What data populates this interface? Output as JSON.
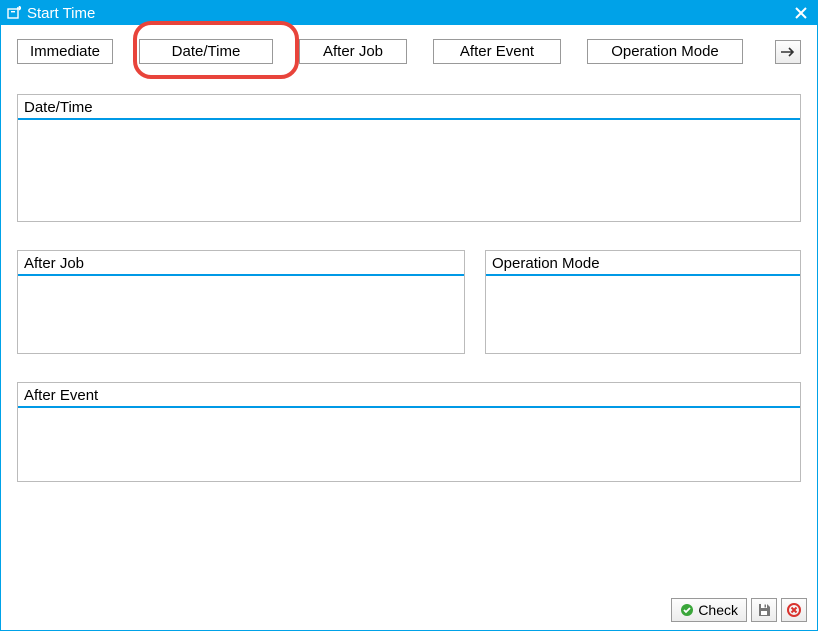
{
  "window": {
    "title": "Start Time"
  },
  "tabs": {
    "immediate": "Immediate",
    "datetime": "Date/Time",
    "afterjob": "After Job",
    "afterevent": "After Event",
    "opmode": "Operation Mode"
  },
  "panels": {
    "datetime": "Date/Time",
    "afterjob": "After Job",
    "opmode": "Operation Mode",
    "afterevent": "After Event"
  },
  "footer": {
    "check": "Check"
  }
}
